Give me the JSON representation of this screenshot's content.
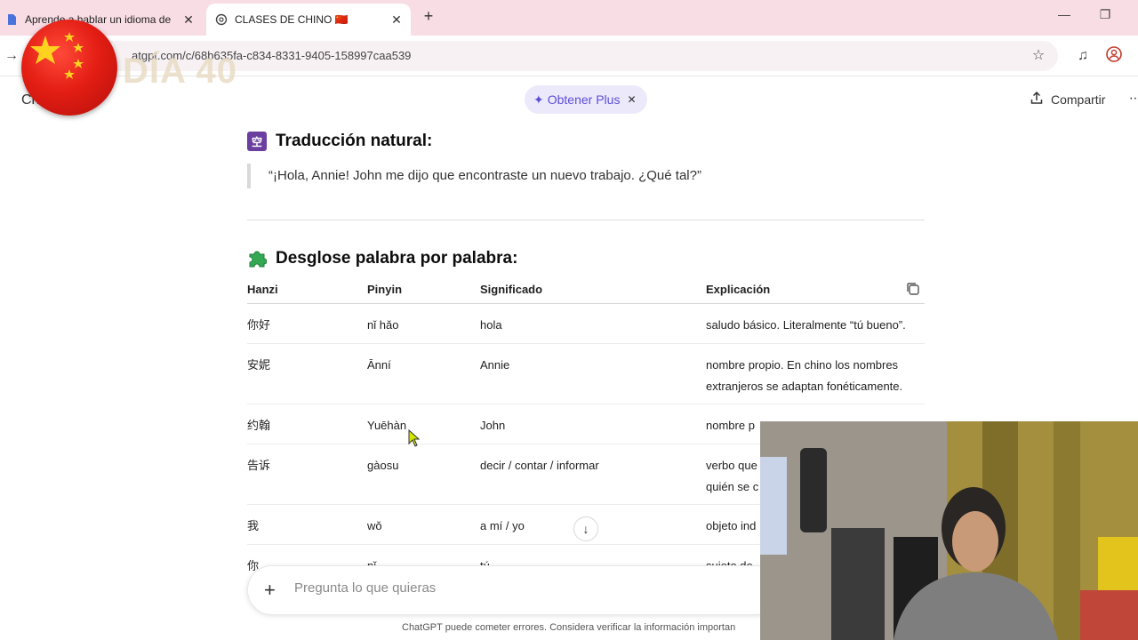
{
  "browser": {
    "tabs": [
      {
        "title": "Aprende a hablar un idioma de",
        "active": false
      },
      {
        "title": "CLASES DE CHINO 🇨🇳",
        "active": true
      }
    ],
    "url": "atgpt.com/c/68b635fa-c834-8331-9405-158997caa539"
  },
  "overlay": {
    "day_label": "DÍA 40"
  },
  "header": {
    "model_label": "Ch",
    "plus_button": "Obtener Plus",
    "share_label": "Compartir"
  },
  "sections": {
    "translation": {
      "heading": "Traducción natural:",
      "quote": "“¡Hola, Annie! John me dijo que encontraste un nuevo trabajo. ¿Qué tal?”"
    },
    "breakdown": {
      "heading": "Desglose palabra por palabra:"
    }
  },
  "table": {
    "headers": [
      "Hanzi",
      "Pinyin",
      "Significado",
      "Explicación"
    ],
    "rows": [
      {
        "hanzi": "你好",
        "pinyin": "nǐ hǎo",
        "significado": "hola",
        "explicacion": "saludo básico. Literalmente “tú bueno”."
      },
      {
        "hanzi": "安妮",
        "pinyin": "Ānní",
        "significado": "Annie",
        "explicacion": "nombre propio. En chino los nombres extranjeros se adaptan fonéticamente."
      },
      {
        "hanzi": "约翰",
        "pinyin": "Yuēhàn",
        "significado": "John",
        "explicacion": "nombre p"
      },
      {
        "hanzi": "告诉",
        "pinyin": "gàosu",
        "significado": "decir / contar / informar",
        "explicacion": "verbo que quién se c"
      },
      {
        "hanzi": "我",
        "pinyin": "wǒ",
        "significado": "a mí / yo",
        "explicacion": "objeto ind"
      },
      {
        "hanzi": "你",
        "pinyin": "nǐ",
        "significado": "tú",
        "explicacion": "sujeto de"
      }
    ]
  },
  "composer": {
    "placeholder": "Pregunta lo que quieras"
  },
  "footer": {
    "disclaimer": "ChatGPT puede cometer errores. Considera verificar la información importan"
  }
}
